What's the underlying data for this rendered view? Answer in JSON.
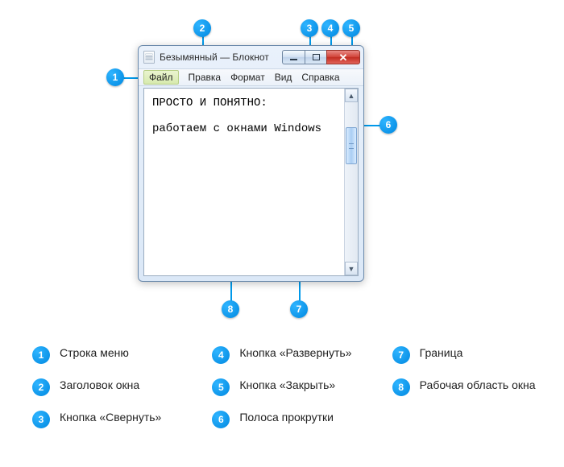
{
  "window": {
    "title": "Безымянный — Блокнот",
    "menu": {
      "file": "Файл",
      "edit": "Правка",
      "format": "Формат",
      "view": "Вид",
      "help": "Справка"
    },
    "body_line1": "ПРОСТО И ПОНЯТНО:",
    "body_line2": "работаем с окнами Windows"
  },
  "callouts": {
    "n1": "1",
    "n2": "2",
    "n3": "3",
    "n4": "4",
    "n5": "5",
    "n6": "6",
    "n7": "7",
    "n8": "8"
  },
  "legend": {
    "i1": "Строка меню",
    "i2": "Заголовок окна",
    "i3": "Кнопка «Свернуть»",
    "i4": "Кнопка «Развернуть»",
    "i5": "Кнопка «Закрыть»",
    "i6": "Полоса прокрутки",
    "i7": "Граница",
    "i8": "Рабочая область окна"
  }
}
